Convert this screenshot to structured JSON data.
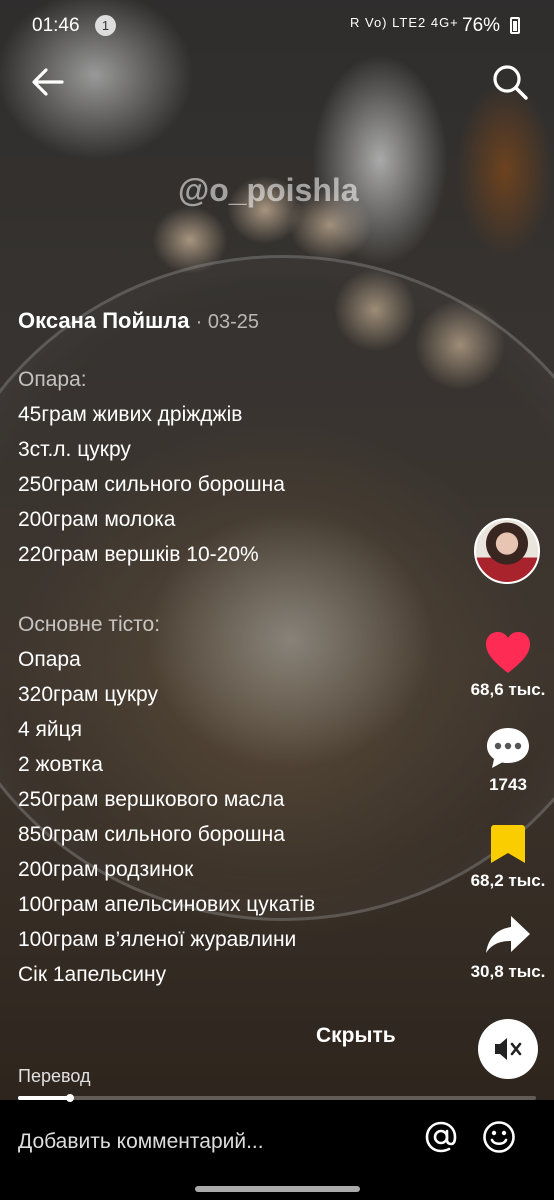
{
  "status_bar": {
    "time": "01:46",
    "notification_count": "1",
    "signal_icons": "R Vo) LTE2 4G+",
    "battery": "76%"
  },
  "video": {
    "watermark": "@o_poishla",
    "progress_fraction": 0.1
  },
  "post": {
    "author": "Оксана Пойшла",
    "date": "· 03-25",
    "caption_lines": [
      "Опара:",
      "45грам живих дріжджів",
      "3ст.л. цукру",
      "250грам сильного борошна",
      "200грам молока",
      "220грам вершків 10-20%",
      "",
      "Основне тісто:",
      "Опара",
      "320грам цукру",
      "4 яйця",
      "2 жовтка",
      "250грам вершкового масла",
      "850грам сильного борошна",
      "200грам родзинок",
      "100грам апельсинових цукатів",
      "100грам в’яленої журавлини",
      "Сік 1апельсину"
    ],
    "hide_label": "Скрыть",
    "translate_label": "Перевод"
  },
  "actions": {
    "likes": "68,6 тыс.",
    "comments": "1743",
    "favorites": "68,2 тыс.",
    "shares": "30,8 тыс."
  },
  "comment_bar": {
    "placeholder": "Добавить комментарий..."
  },
  "colors": {
    "like": "#fe2c55",
    "favorite": "#facd00"
  }
}
